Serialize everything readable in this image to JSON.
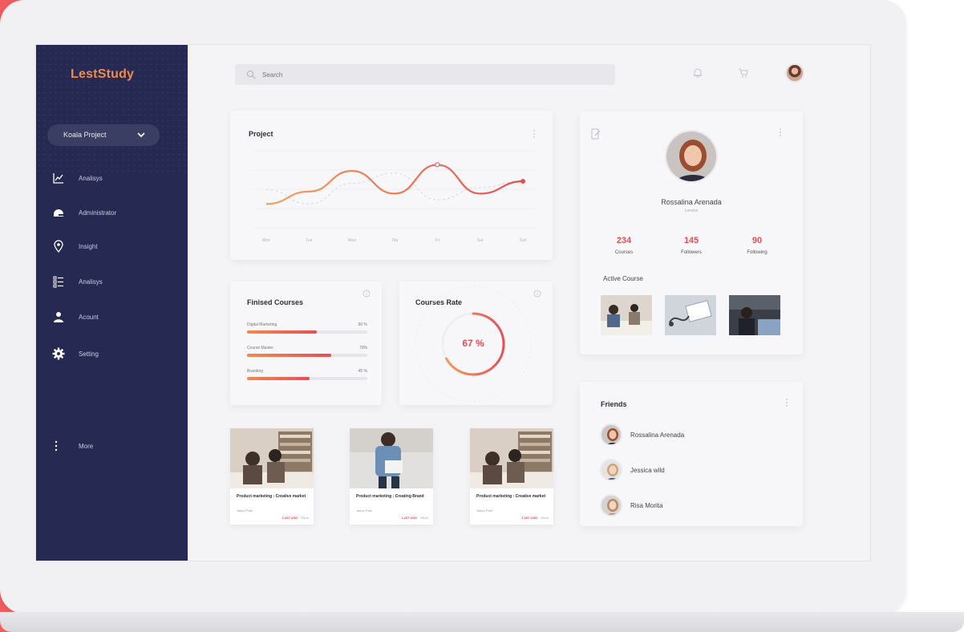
{
  "colors": {
    "accent": "#ef5d5d",
    "sidebar": "#262a52",
    "brand_orange": "#f08a4b",
    "brand_red": "#e84d55"
  },
  "app": {
    "logo": "LestStudy"
  },
  "sidebar": {
    "project_select": "Koala Project",
    "items": [
      {
        "label": "Analisys",
        "icon": "chart-line-icon"
      },
      {
        "label": "Administrator",
        "icon": "helmet-icon"
      },
      {
        "label": "Insight",
        "icon": "location-pin-icon"
      },
      {
        "label": "Analisys",
        "icon": "list-checks-icon"
      },
      {
        "label": "Acount",
        "icon": "user-icon"
      },
      {
        "label": "Setting",
        "icon": "gear-icon"
      }
    ],
    "more": "More"
  },
  "header": {
    "search_placeholder": "Search"
  },
  "project": {
    "title": "Project",
    "chart_data": {
      "type": "line",
      "categories": [
        "Mon",
        "Tue",
        "Wed",
        "Thu",
        "Fri",
        "Sat",
        "Sun"
      ],
      "series": [
        {
          "values": [
            2.0,
            3.2,
            5.2,
            3.0,
            5.8,
            3.0,
            4.2
          ]
        },
        {
          "values": [
            3.4,
            2.0,
            4.0,
            5.0,
            2.4,
            3.6,
            4.2
          ]
        }
      ],
      "ylim": [
        0,
        7
      ],
      "grid": true
    }
  },
  "finished_courses": {
    "title": "Finised Courses",
    "items": [
      {
        "label": "Digital Marketing",
        "pct_text": "60 %",
        "value": 0.58
      },
      {
        "label": "Course Master",
        "pct_text": "70%",
        "value": 0.7
      },
      {
        "label": "Branding",
        "pct_text": "45 %",
        "value": 0.52
      }
    ]
  },
  "courses_rate": {
    "title": "Courses Rate",
    "value_text": "67 %",
    "value": 0.67
  },
  "course_tiles": [
    {
      "title": "Product marketing : Creative market",
      "author": "Jason Park",
      "price": "1,267 USD",
      "old_price": "25hrs"
    },
    {
      "title": "Product marketing : Creating Brand",
      "author": "Jason Park",
      "price": "1,267 USD",
      "old_price": "25hrs"
    },
    {
      "title": "Product marketing : Creative market",
      "author": "Jason Park",
      "price": "1,267 USD",
      "old_price": "25hrs"
    }
  ],
  "profile": {
    "name": "Rossalina Arenada",
    "role": "London",
    "stats": [
      {
        "num": "234",
        "label": "Courses"
      },
      {
        "num": "145",
        "label": "Followers"
      },
      {
        "num": "90",
        "label": "Following"
      }
    ],
    "active_title": "Active Course"
  },
  "friends": {
    "title": "Friends",
    "items": [
      {
        "name": "Rossalina Arenada"
      },
      {
        "name": "Jessica wild"
      },
      {
        "name": "Risa Morita"
      }
    ]
  }
}
